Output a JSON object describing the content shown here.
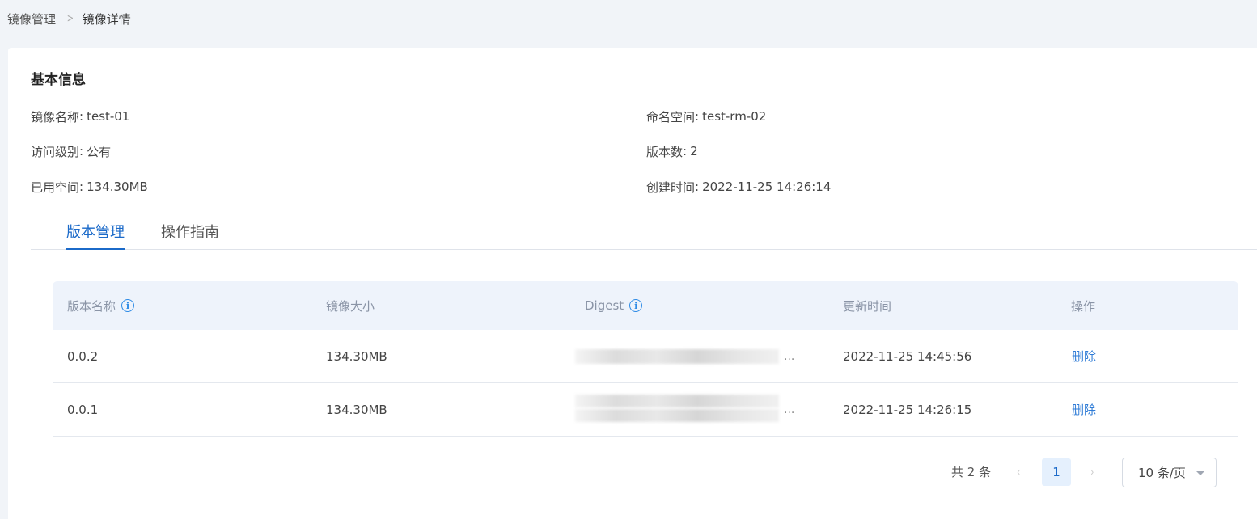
{
  "breadcrumb": {
    "parent": "镜像管理",
    "separator": ">",
    "current": "镜像详情"
  },
  "basic_info": {
    "title": "基本信息",
    "colon": ":",
    "image_name": {
      "label": "镜像名称",
      "value": "test-01"
    },
    "namespace": {
      "label": "命名空间",
      "value": "test-rm-02"
    },
    "access_level": {
      "label": "访问级别",
      "value": "公有"
    },
    "version_count": {
      "label": "版本数",
      "value": "2"
    },
    "used_space": {
      "label": "已用空间",
      "value": "134.30MB"
    },
    "created_time": {
      "label": "创建时间",
      "value": "2022-11-25 14:26:14"
    }
  },
  "tabs": [
    {
      "label": "版本管理",
      "active": true
    },
    {
      "label": "操作指南",
      "active": false
    }
  ],
  "table": {
    "columns": [
      {
        "label": "版本名称",
        "info_icon": true
      },
      {
        "label": "镜像大小",
        "info_icon": false
      },
      {
        "label": "Digest",
        "info_icon": true
      },
      {
        "label": "更新时间",
        "info_icon": false
      },
      {
        "label": "操作",
        "info_icon": false
      }
    ],
    "info_icon_glyph": "i",
    "rows": [
      {
        "version": "0.0.2",
        "size": "134.30MB",
        "digest_ellipsis": "...",
        "updated": "2022-11-25 14:45:56",
        "action": "删除"
      },
      {
        "version": "0.0.1",
        "size": "134.30MB",
        "digest_ellipsis": "...",
        "updated": "2022-11-25 14:26:15",
        "action": "删除"
      }
    ]
  },
  "pagination": {
    "total": "共 2 条",
    "prev": "‹",
    "page": "1",
    "next": "›",
    "page_size": "10 条/页"
  },
  "colors": {
    "accent": "#1b6ac9",
    "link": "#2e7bd6",
    "header_bg": "#eef3fb",
    "page_bg": "#f1f4f8"
  }
}
